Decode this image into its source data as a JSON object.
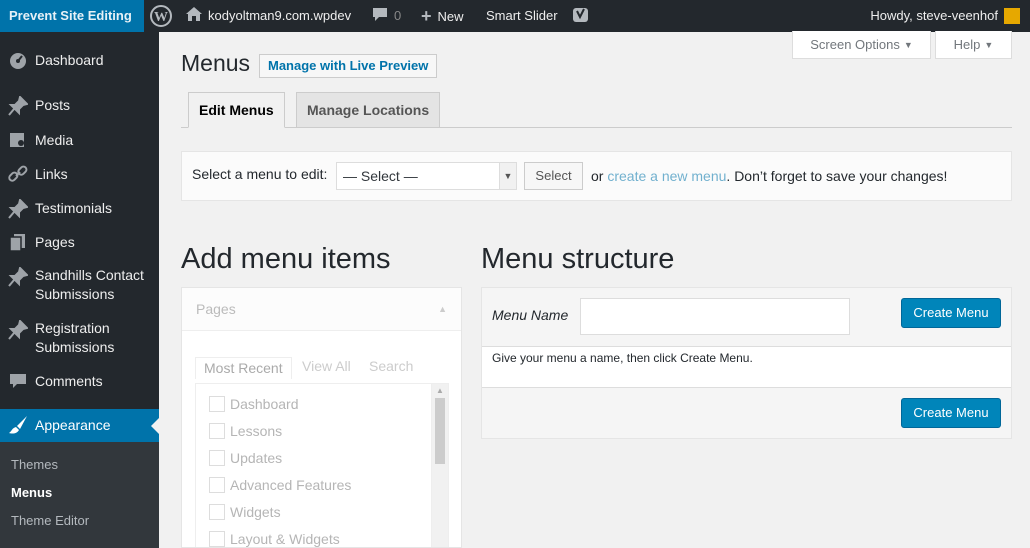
{
  "adminbar": {
    "site_title": "Prevent Site Editing",
    "home_label": "kodyoltman9.com.wpdev",
    "comments_count": "0",
    "new_label": "New",
    "slider_label": "Smart Slider",
    "howdy": "Howdy, steve-veenhof"
  },
  "sidebar": {
    "items": [
      {
        "label": "Dashboard",
        "icon": "dashboard-icon"
      },
      {
        "label": "Posts",
        "icon": "pin-icon"
      },
      {
        "label": "Media",
        "icon": "media-icon"
      },
      {
        "label": "Links",
        "icon": "link-icon"
      },
      {
        "label": "Testimonials",
        "icon": "pin-icon"
      },
      {
        "label": "Pages",
        "icon": "pages-icon"
      },
      {
        "label": "Sandhills Contact Submissions",
        "icon": "pin-icon"
      },
      {
        "label": "Registration Submissions",
        "icon": "pin-icon"
      },
      {
        "label": "Comments",
        "icon": "comment-icon"
      },
      {
        "label": "Appearance",
        "icon": "brush-icon"
      }
    ],
    "submenu": [
      "Themes",
      "Menus",
      "Theme Editor"
    ]
  },
  "header": {
    "screen_options": "Screen Options",
    "help": "Help",
    "title": "Menus",
    "live_preview": "Manage with Live Preview"
  },
  "tabs": [
    "Edit Menus",
    "Manage Locations"
  ],
  "select_menu": {
    "label": "Select a menu to edit:",
    "selected": "— Select —",
    "button": "Select",
    "hint_prefix": "or",
    "create_link": "create a new menu",
    "hint_suffix": ". Don’t forget to save your changes!"
  },
  "add_items": {
    "title": "Add menu items",
    "pages_title": "Pages",
    "inner_tabs": [
      "Most Recent",
      "View All",
      "Search"
    ],
    "pages": [
      "Dashboard",
      "Lessons",
      "Updates",
      "Advanced Features",
      "Widgets",
      "Layout & Widgets"
    ]
  },
  "structure": {
    "title": "Menu structure",
    "menu_name_label": "Menu Name",
    "menu_name_value": "",
    "create_button": "Create Menu",
    "hint": "Give your menu a name, then click Create Menu."
  },
  "colors": {
    "adminbar_bg": "#23282d",
    "accent": "#0073aa",
    "primary_button": "#0085ba"
  }
}
